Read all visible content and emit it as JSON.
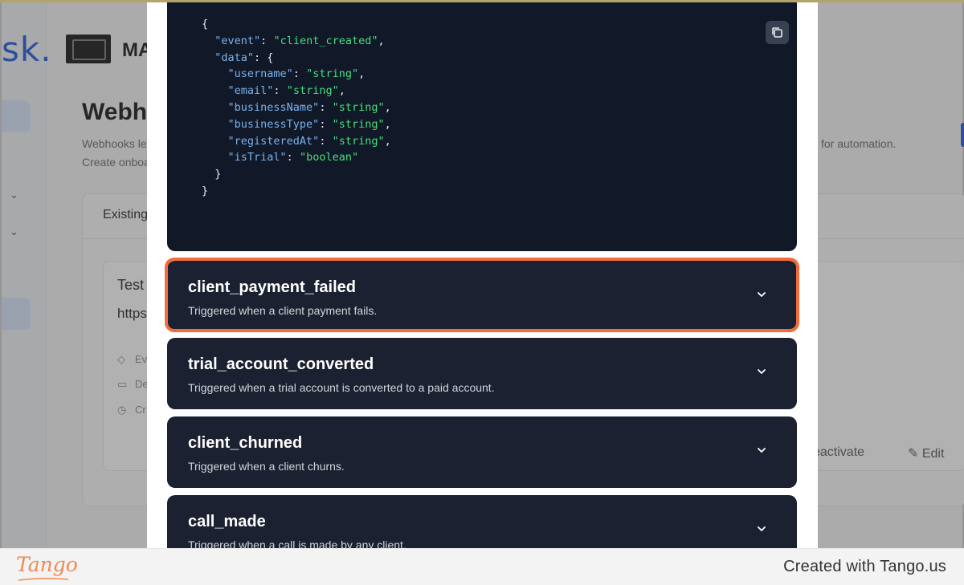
{
  "background": {
    "logo_text": "sk.",
    "brand_text": "MA",
    "page_title": "Webh",
    "description_line1": "Webhooks le",
    "description_line2": "Create onboa",
    "description_right": "for automation.",
    "card_header": "Existing",
    "item_title": "Test",
    "item_url": "https:",
    "meta": [
      "Ev",
      "De",
      "Cr"
    ],
    "deactivate_label": "eactivate",
    "edit_label": "Edit"
  },
  "code": {
    "lines": [
      [
        {
          "t": "p",
          "v": "{"
        }
      ],
      [
        {
          "t": "p",
          "v": "  "
        },
        {
          "t": "k",
          "v": "\"event\""
        },
        {
          "t": "p",
          "v": ": "
        },
        {
          "t": "s",
          "v": "\"client_created\""
        },
        {
          "t": "p",
          "v": ","
        }
      ],
      [
        {
          "t": "p",
          "v": "  "
        },
        {
          "t": "k",
          "v": "\"data\""
        },
        {
          "t": "p",
          "v": ": {"
        }
      ],
      [
        {
          "t": "p",
          "v": "    "
        },
        {
          "t": "k",
          "v": "\"username\""
        },
        {
          "t": "p",
          "v": ": "
        },
        {
          "t": "s",
          "v": "\"string\""
        },
        {
          "t": "p",
          "v": ","
        }
      ],
      [
        {
          "t": "p",
          "v": "    "
        },
        {
          "t": "k",
          "v": "\"email\""
        },
        {
          "t": "p",
          "v": ": "
        },
        {
          "t": "s",
          "v": "\"string\""
        },
        {
          "t": "p",
          "v": ","
        }
      ],
      [
        {
          "t": "p",
          "v": "    "
        },
        {
          "t": "k",
          "v": "\"businessName\""
        },
        {
          "t": "p",
          "v": ": "
        },
        {
          "t": "s",
          "v": "\"string\""
        },
        {
          "t": "p",
          "v": ","
        }
      ],
      [
        {
          "t": "p",
          "v": "    "
        },
        {
          "t": "k",
          "v": "\"businessType\""
        },
        {
          "t": "p",
          "v": ": "
        },
        {
          "t": "s",
          "v": "\"string\""
        },
        {
          "t": "p",
          "v": ","
        }
      ],
      [
        {
          "t": "p",
          "v": "    "
        },
        {
          "t": "k",
          "v": "\"registeredAt\""
        },
        {
          "t": "p",
          "v": ": "
        },
        {
          "t": "s",
          "v": "\"string\""
        },
        {
          "t": "p",
          "v": ","
        }
      ],
      [
        {
          "t": "p",
          "v": "    "
        },
        {
          "t": "k",
          "v": "\"isTrial\""
        },
        {
          "t": "p",
          "v": ": "
        },
        {
          "t": "s",
          "v": "\"boolean\""
        }
      ],
      [
        {
          "t": "p",
          "v": "  }"
        }
      ],
      [
        {
          "t": "p",
          "v": "}"
        }
      ]
    ],
    "copy_icon": "copy-icon"
  },
  "events": [
    {
      "name": "client_payment_failed",
      "description": "Triggered when a client payment fails.",
      "highlighted": true
    },
    {
      "name": "trial_account_converted",
      "description": "Triggered when a trial account is converted to a paid account.",
      "highlighted": false
    },
    {
      "name": "client_churned",
      "description": "Triggered when a client churns.",
      "highlighted": false
    },
    {
      "name": "call_made",
      "description": "Triggered when a call is made by any client.",
      "highlighted": false
    }
  ],
  "footer": {
    "logo": "Tango",
    "created_text": "Created with Tango.us"
  },
  "colors": {
    "highlight": "#f26b3a",
    "code_bg": "#111827",
    "event_bg": "#1b2130",
    "json_key": "#7ab3f0",
    "json_string": "#4ade80",
    "tango_orange": "#f08a52"
  }
}
